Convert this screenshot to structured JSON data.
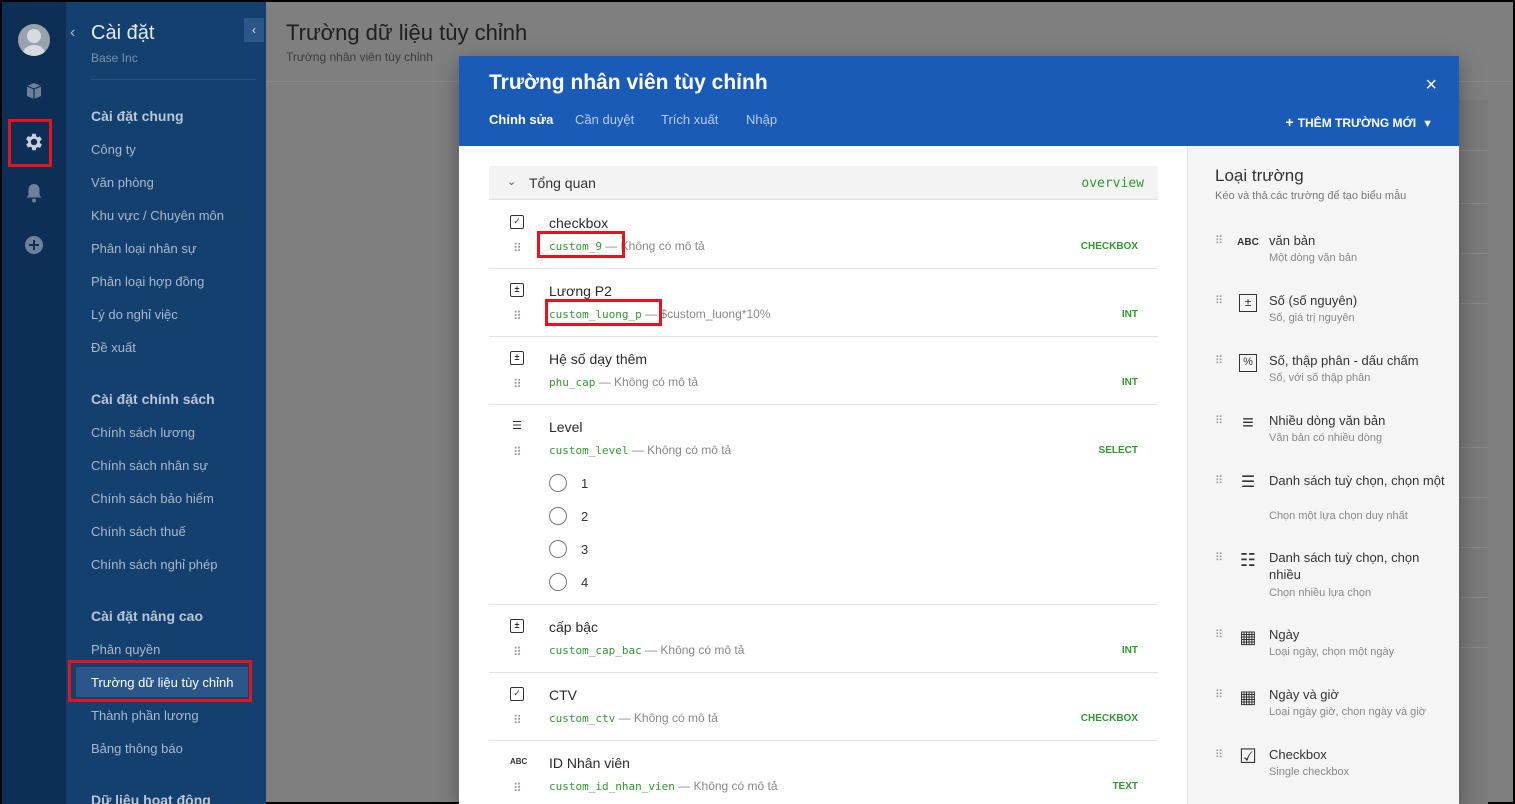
{
  "rail": {
    "icons": [
      "avatar",
      "box-icon",
      "gear-icon",
      "bell-icon",
      "plus-circle-icon"
    ]
  },
  "sidebar": {
    "title": "Cài đặt",
    "subtitle": "Base Inc",
    "sections": [
      {
        "heading": "Cài đặt chung",
        "items": [
          "Công ty",
          "Văn phòng",
          "Khu vực / Chuyên môn",
          "Phân loại nhân sự",
          "Phân loại hợp đồng",
          "Lý do nghỉ việc",
          "Đề xuất"
        ]
      },
      {
        "heading": "Cài đặt chính sách",
        "items": [
          "Chính sách lương",
          "Chính sách nhân sự",
          "Chính sách bảo hiểm",
          "Chính sách thuế",
          "Chính sách nghỉ phép"
        ]
      },
      {
        "heading": "Cài đặt nâng cao",
        "items": [
          "Phân quyền",
          "Trường dữ liệu tùy chỉnh",
          "Thành phần lương",
          "Bảng thông báo"
        ]
      },
      {
        "heading": "Dữ liệu hoạt động",
        "items": []
      }
    ],
    "active_item": "Trường dữ liệu tùy chỉnh"
  },
  "page": {
    "title": "Trường dữ liệu tùy chỉnh",
    "subtitle": "Trường nhân viên tùy chỉnh"
  },
  "modal": {
    "title": "Trường nhân viên tùy chỉnh",
    "close": "×",
    "tabs": [
      "Chỉnh sửa",
      "Cần duyệt",
      "Trích xuất",
      "Nhập"
    ],
    "active_tab": "Chỉnh sửa",
    "add_field": "THÊM TRƯỜNG MỚI",
    "group": {
      "name": "Tổng quan",
      "code": "overview"
    },
    "fields": [
      {
        "label": "checkbox",
        "key": "custom_9",
        "desc": "Không có mô tả",
        "kind": "CHECKBOX",
        "icon": "checkbox-icon"
      },
      {
        "label": "Lương P2",
        "key": "custom_luong_p",
        "desc": "$custom_luong*10%",
        "kind": "INT",
        "icon": "integer-icon"
      },
      {
        "label": "Hệ số dạy thêm",
        "key": "phu_cap",
        "desc": "Không có mô tả",
        "kind": "INT",
        "icon": "integer-icon"
      },
      {
        "label": "Level",
        "key": "custom_level",
        "desc": "Không có mô tả",
        "kind": "SELECT",
        "icon": "select-list-icon",
        "options": [
          "1",
          "2",
          "3",
          "4"
        ]
      },
      {
        "label": "cấp bậc",
        "key": "custom_cap_bac",
        "desc": "Không có mô tả",
        "kind": "INT",
        "icon": "integer-icon"
      },
      {
        "label": "CTV",
        "key": "custom_ctv",
        "desc": "Không có mô tả",
        "kind": "CHECKBOX",
        "icon": "checkbox-icon"
      },
      {
        "label": "ID Nhân viên",
        "key": "custom_id_nhan_vien",
        "desc": "Không có mô tả",
        "kind": "TEXT",
        "icon": "abc-icon"
      }
    ]
  },
  "palette": {
    "title": "Loại trường",
    "subtitle": "Kéo và thả các trường để tạo biểu mẫu",
    "types": [
      {
        "name": "văn bản",
        "desc": "Một dòng văn bản",
        "icon": "abc-icon",
        "glyph": "ABC"
      },
      {
        "name": "Số (số nguyên)",
        "desc": "Số, giá trị nguyên",
        "icon": "integer-icon",
        "glyph": "±"
      },
      {
        "name": "Số, thập phân - dấu chấm",
        "desc": "Số, với số thập phân",
        "icon": "percent-icon",
        "glyph": "%"
      },
      {
        "name": "Nhiều dòng văn bản",
        "desc": "Văn bản có nhiều dòng",
        "icon": "multiline-icon",
        "glyph": "≡"
      },
      {
        "name": "Danh sách tuỳ chọn, chọn một",
        "desc": "Chọn một lựa chọn duy nhất",
        "icon": "single-select-icon",
        "glyph": "☰"
      },
      {
        "name": "Danh sách tuỳ chọn, chọn nhiều",
        "desc": "Chọn nhiều lựa chọn",
        "icon": "multi-select-icon",
        "glyph": "☷"
      },
      {
        "name": "Ngày",
        "desc": "Loại ngày, chọn một ngày",
        "icon": "calendar-icon",
        "glyph": "▦"
      },
      {
        "name": "Ngày và giờ",
        "desc": "Loại ngày giờ, chọn ngày và giờ",
        "icon": "calendar-time-icon",
        "glyph": "▦"
      },
      {
        "name": "Checkbox",
        "desc": "Single checkbox",
        "icon": "checkbox-icon",
        "glyph": "☑"
      }
    ]
  },
  "colors": {
    "rail": "#0d2f56",
    "sidebar": "#14406f",
    "modal_header": "#1a5bb8",
    "key_green": "#2f9a2f",
    "highlight_red": "#e8121d"
  }
}
